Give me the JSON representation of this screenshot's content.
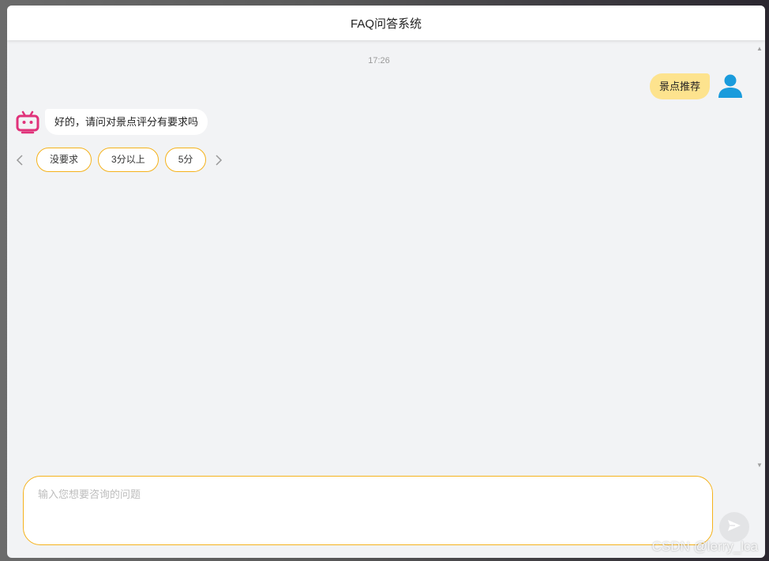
{
  "header": {
    "title": "FAQ问答系统"
  },
  "chat": {
    "timestamp": "17:26",
    "user_message": "景点推荐",
    "bot_message": "好的，请问对景点评分有要求吗",
    "options": [
      {
        "label": "没要求"
      },
      {
        "label": "3分以上"
      },
      {
        "label": "5分"
      }
    ],
    "prev_icon": "chevron-left-icon",
    "next_icon": "chevron-right-icon"
  },
  "input": {
    "placeholder": "输入您想要咨询的问题",
    "value": ""
  },
  "watermark": "CSDN @lerry_lca",
  "colors": {
    "accent": "#f5b21b",
    "user_bubble": "#fde38e",
    "user_avatar": "#1a9bdc",
    "bot_avatar": "#e0327a",
    "background": "#f2f3f5"
  }
}
